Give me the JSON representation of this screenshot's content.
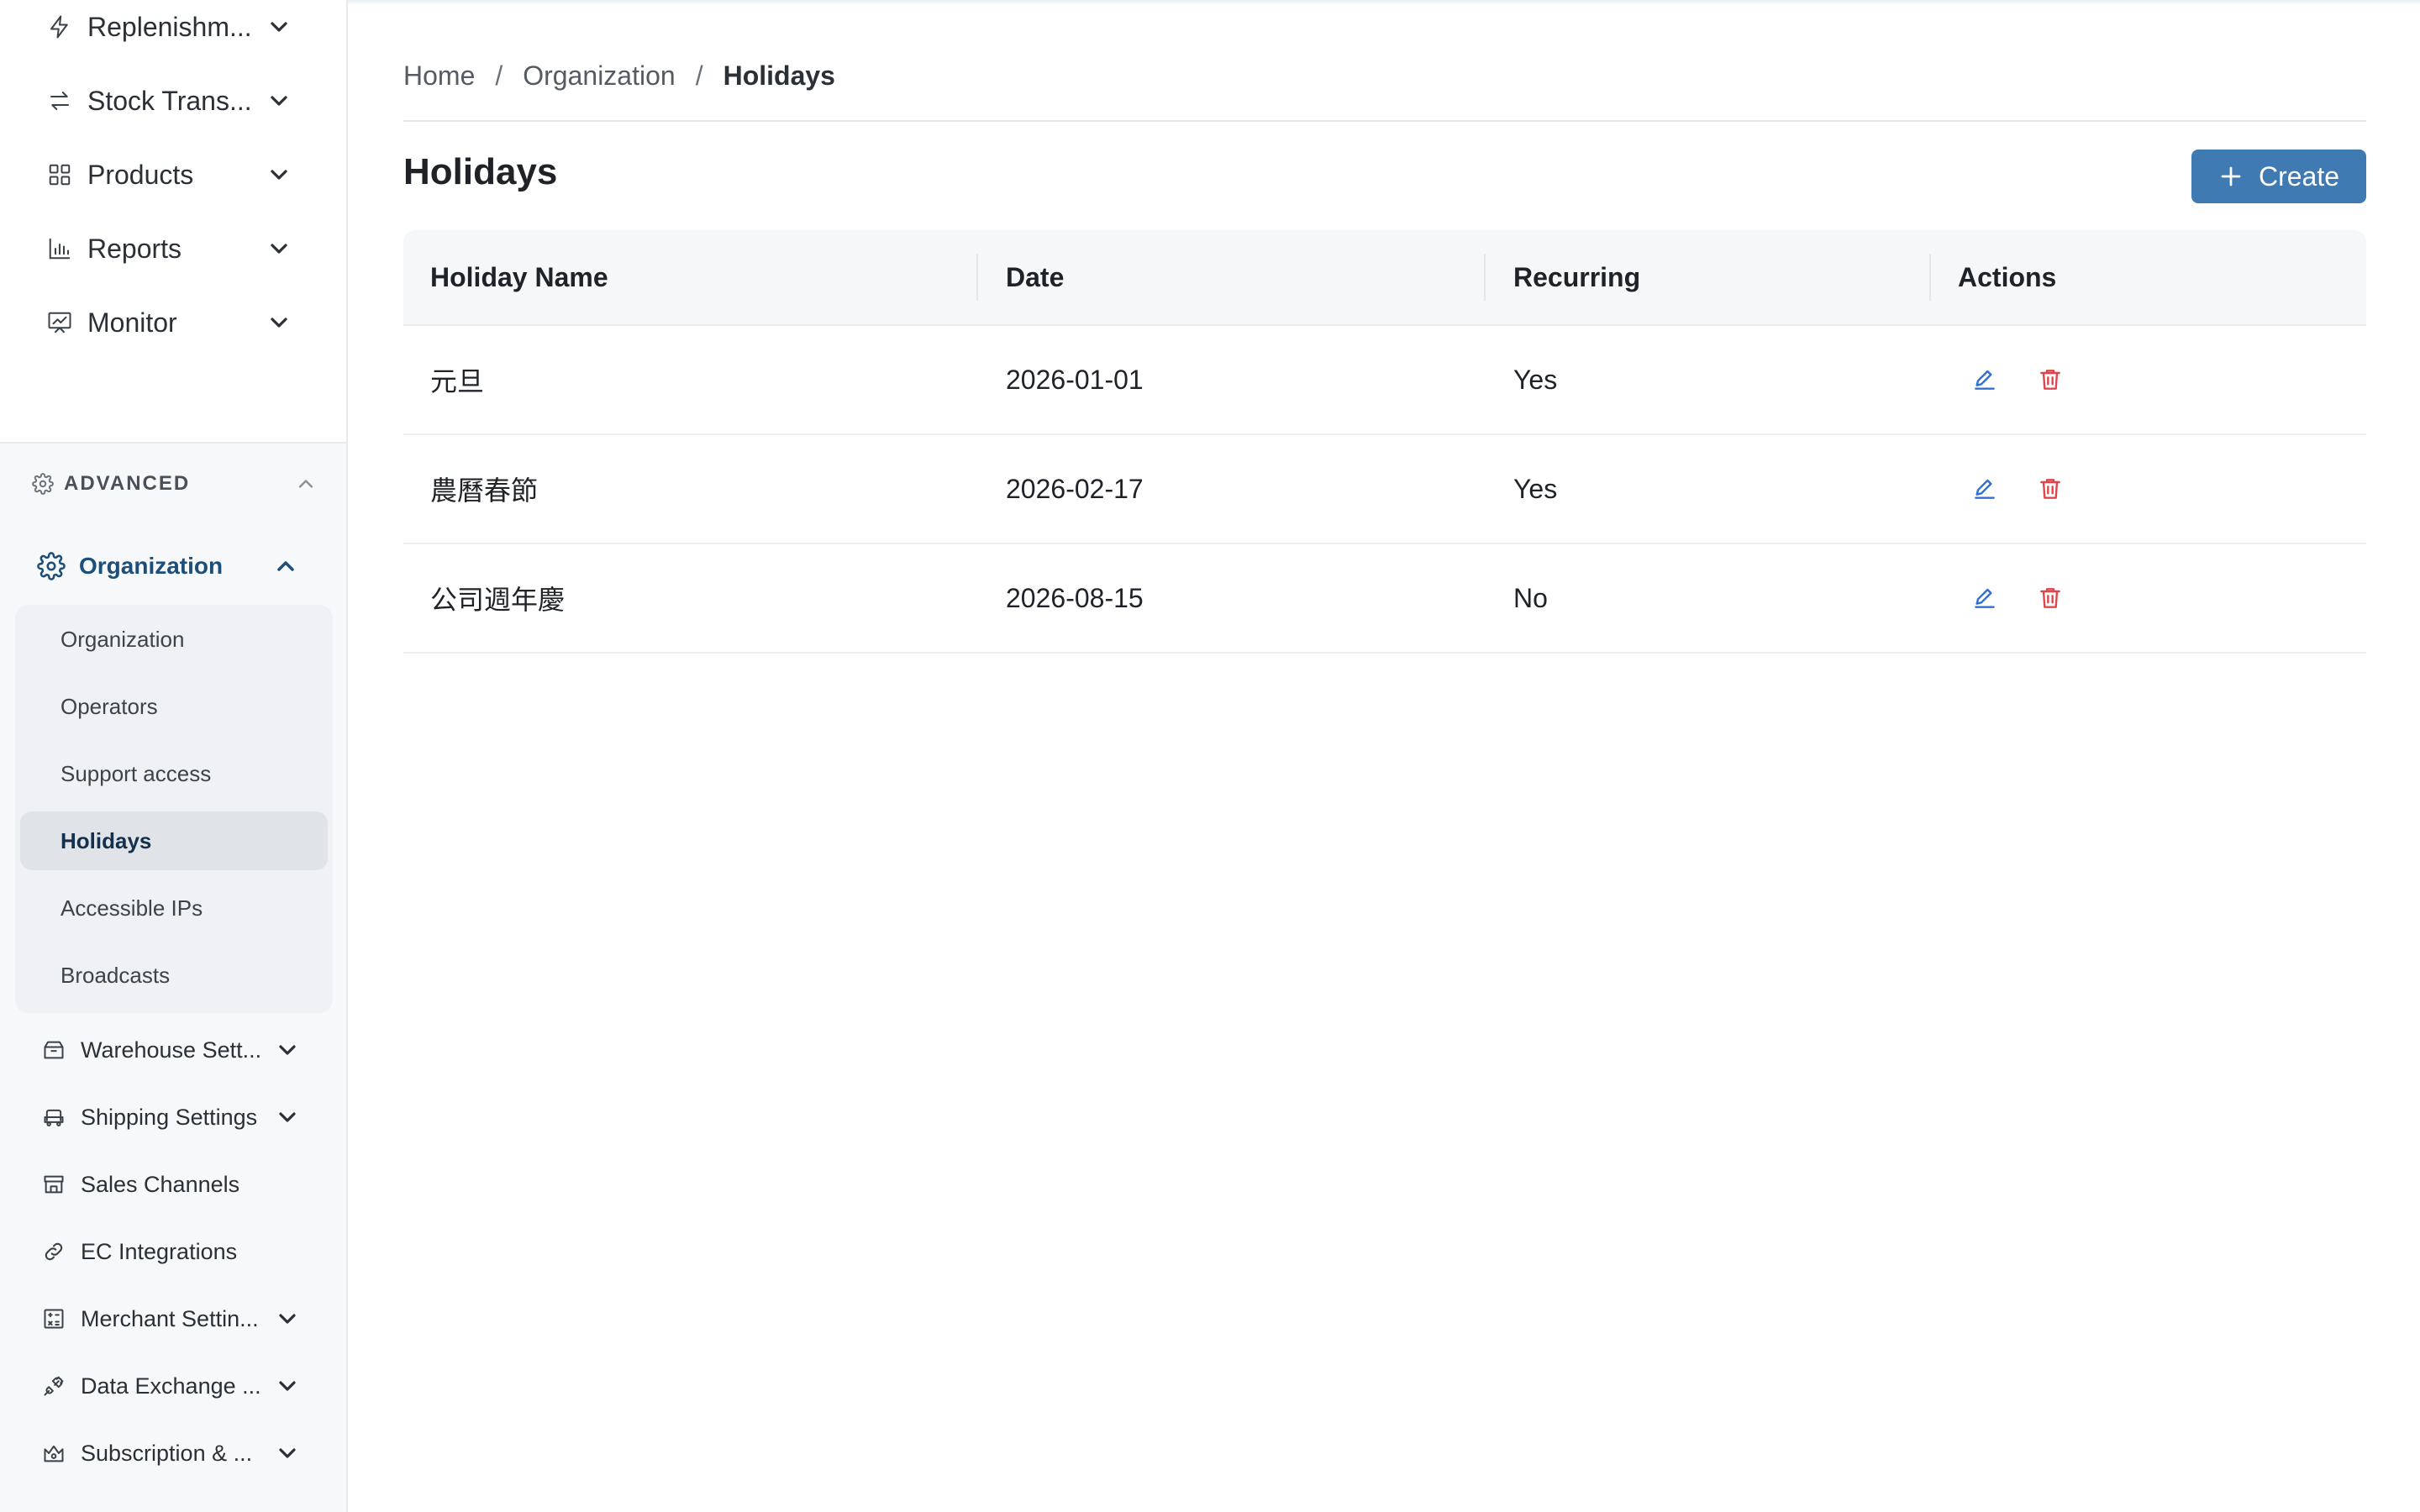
{
  "sidebar": {
    "top_items": [
      {
        "label": "Replenishm...",
        "icon": "lightning-icon"
      },
      {
        "label": "Stock Trans...",
        "icon": "transfer-arrows-icon"
      },
      {
        "label": "Products",
        "icon": "grid-icon"
      },
      {
        "label": "Reports",
        "icon": "bar-chart-icon"
      },
      {
        "label": "Monitor",
        "icon": "monitor-chart-icon"
      }
    ],
    "advanced_label": "ADVANCED",
    "org_parent_label": "Organization",
    "org_sub_items": [
      {
        "label": "Organization"
      },
      {
        "label": "Operators"
      },
      {
        "label": "Support access"
      },
      {
        "label": "Holidays",
        "active": true
      },
      {
        "label": "Accessible IPs"
      },
      {
        "label": "Broadcasts"
      }
    ],
    "section_items": [
      {
        "label": "Warehouse Sett...",
        "icon": "warehouse-icon",
        "has_chevron": true
      },
      {
        "label": "Shipping Settings",
        "icon": "truck-icon",
        "has_chevron": true
      },
      {
        "label": "Sales Channels",
        "icon": "store-icon",
        "has_chevron": false
      },
      {
        "label": "EC Integrations",
        "icon": "link-icon",
        "has_chevron": false
      },
      {
        "label": "Merchant Settin...",
        "icon": "calculator-icon",
        "has_chevron": true
      },
      {
        "label": "Data Exchange ...",
        "icon": "plug-icon",
        "has_chevron": true
      },
      {
        "label": "Subscription & ...",
        "icon": "crown-icon",
        "has_chevron": true
      }
    ]
  },
  "breadcrumb": {
    "home": "Home",
    "separator": "/",
    "parent": "Organization",
    "current": "Holidays"
  },
  "page": {
    "title": "Holidays",
    "create_label": "Create"
  },
  "table": {
    "columns": [
      "Holiday Name",
      "Date",
      "Recurring",
      "Actions"
    ],
    "rows": [
      {
        "name": "元旦",
        "date": "2026-01-01",
        "recurring": "Yes"
      },
      {
        "name": "農曆春節",
        "date": "2026-02-17",
        "recurring": "Yes"
      },
      {
        "name": "公司週年慶",
        "date": "2026-08-15",
        "recurring": "No"
      }
    ]
  },
  "colors": {
    "primary": "#3f7ab3",
    "active_text": "#1d4e78",
    "edit_icon": "#2f6fd6",
    "delete_icon": "#e0454b"
  }
}
